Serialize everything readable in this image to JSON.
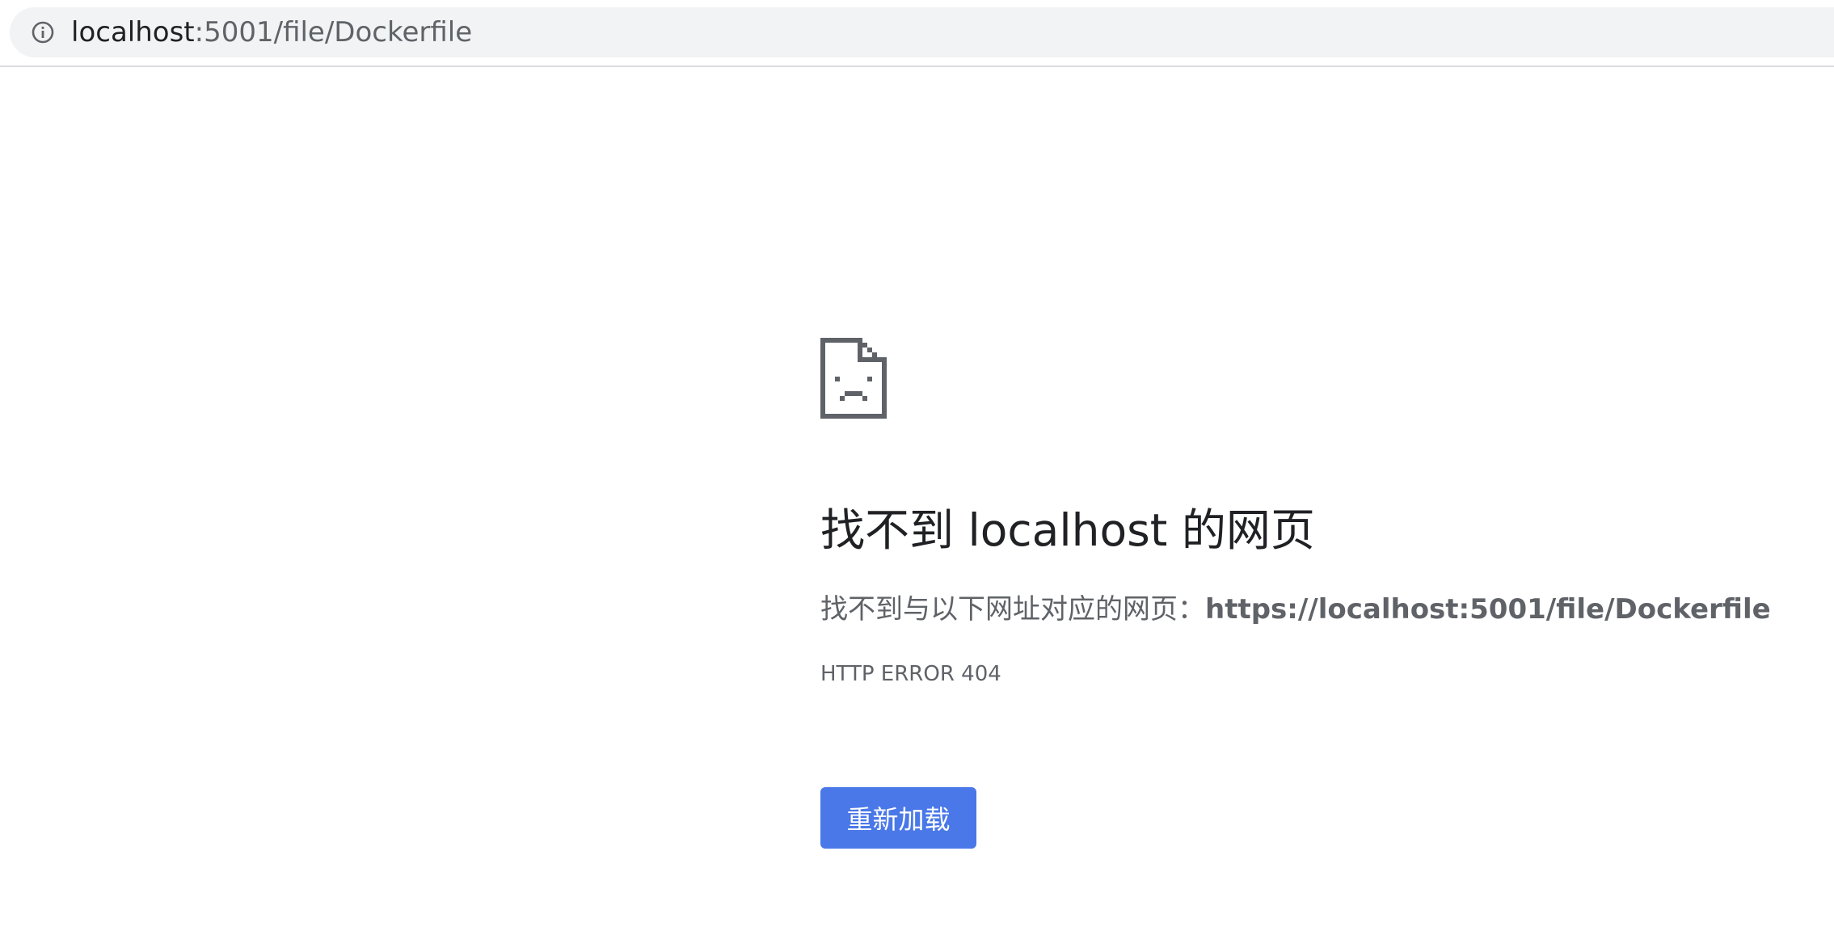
{
  "address_bar": {
    "host": "localhost",
    "path": ":5001/file/Dockerfile",
    "icon": "info-circle-icon"
  },
  "error_page": {
    "icon": "sad-file-icon",
    "headline": "找不到 localhost 的网页",
    "details_prefix": "找不到与以下网址对应的网页：",
    "details_url": "https://localhost:5001/file/Dockerfile",
    "error_code": "HTTP ERROR 404",
    "reload_label": "重新加载"
  },
  "colors": {
    "button": "#4a78e8",
    "icon": "#5f6368"
  }
}
